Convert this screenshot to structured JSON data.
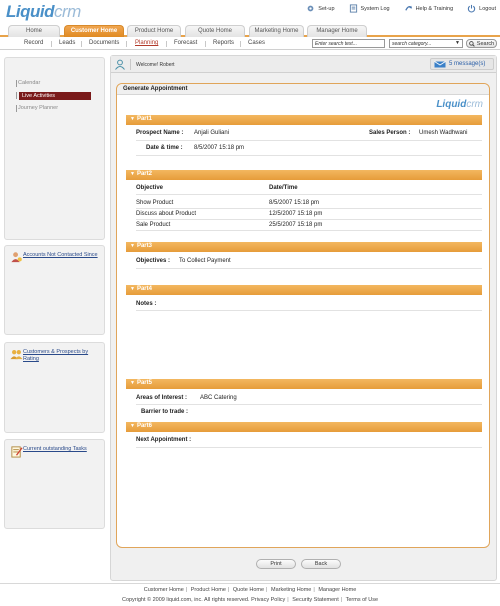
{
  "header": {
    "logo_primary": "Liquid",
    "logo_secondary": "crm",
    "links": [
      {
        "label": "Set-up",
        "icon": "gear-icon"
      },
      {
        "label": "System Log",
        "icon": "system-log-icon"
      },
      {
        "label": "Help & Training",
        "icon": "help-icon"
      },
      {
        "label": "Logout",
        "icon": "logout-icon"
      }
    ]
  },
  "tabs": [
    {
      "label": "Home",
      "active": false
    },
    {
      "label": "Customer Home",
      "active": true
    },
    {
      "label": "Product Home",
      "active": false
    },
    {
      "label": "Quote Home",
      "active": false
    },
    {
      "label": "Marketing Home",
      "active": false
    },
    {
      "label": "Manager Home",
      "active": false
    }
  ],
  "subnav": {
    "links": [
      "Record",
      "Leads",
      "Documents",
      "Planning",
      "Forecast",
      "Reports",
      "Cases"
    ],
    "active": "Planning",
    "search_placeholder": "Enter search text...",
    "category_value": "search category...",
    "search_button": "Search"
  },
  "sidebar": {
    "menu": [
      "Calendar",
      "Live Activities",
      "Journey Planner"
    ],
    "active_menu": "Live Activities",
    "widgets": [
      {
        "title": "Accounts Not Contacted Since",
        "icon": "person-icon"
      },
      {
        "title": "Customers & Prospects by Rating",
        "icon": "users-icon"
      },
      {
        "title": "Current outstanding Tasks",
        "icon": "tasks-icon"
      }
    ]
  },
  "main": {
    "welcome": "Welcome! Robert",
    "messages": "5 message(s)",
    "form_title": "Generate Appointment",
    "brand_primary": "Liquid",
    "brand_secondary": "crm",
    "part1": {
      "title": "Part1",
      "prospect_label": "Prospect Name :",
      "prospect_value": "Anjali Guliani",
      "salesperson_label": "Sales Person :",
      "salesperson_value": "Umesh Wadhwani",
      "datetime_label": "Date & time :",
      "datetime_value": "8/5/2007  15:18 pm"
    },
    "part2": {
      "title": "Part2",
      "col_objective": "Objective",
      "col_datetime": "Date/Time",
      "rows": [
        {
          "objective": "Show Product",
          "datetime": "8/5/2007  15:18 pm"
        },
        {
          "objective": "Discuss about Product",
          "datetime": "12/5/2007  15:18 pm"
        },
        {
          "objective": "Sale Product",
          "datetime": "25/5/2007  15:18 pm"
        }
      ]
    },
    "part3": {
      "title": "Part3",
      "objectives_label": "Objectives :",
      "objectives_value": "To Collect Payment"
    },
    "part4": {
      "title": "Part4",
      "notes_label": "Notes :"
    },
    "part5": {
      "title": "Part5",
      "interest_label": "Areas of Interest :",
      "interest_value": "ABC Catering",
      "barrier_label": "Barrier to trade :"
    },
    "part6": {
      "title": "Part6",
      "next_label": "Next Appointment :"
    },
    "print_button": "Print",
    "back_button": "Back"
  },
  "footer": {
    "links": [
      "Customer Home",
      "Product Home",
      "Quote Home",
      "Marketing Home",
      "Manager Home"
    ],
    "copyright": "Copyright © 2009 liquid.com, inc. All rights reserved.",
    "legal": [
      "Privacy Policy",
      "Security Statement",
      "Terms of Use"
    ]
  },
  "colors": {
    "accent_orange": "#e69c3a",
    "logo_blue": "#4a90c8",
    "active_menu": "#7a1a1a"
  }
}
